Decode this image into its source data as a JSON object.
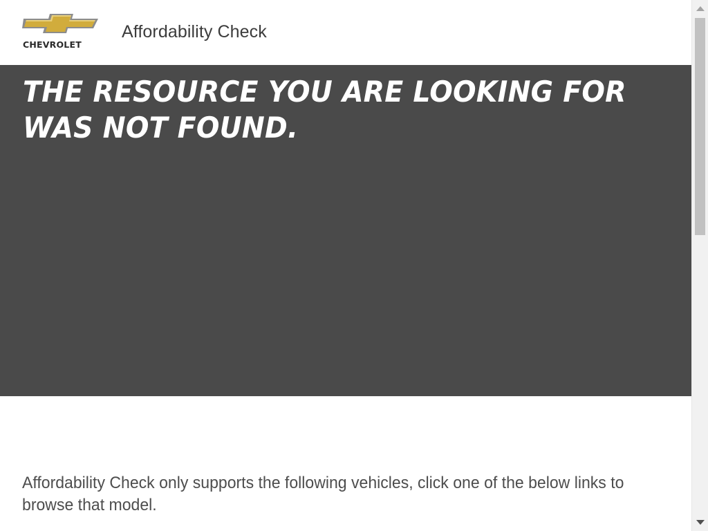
{
  "header": {
    "logo": {
      "icon": "chevrolet-bowtie-icon",
      "wordmark": "CHEVROLET",
      "colors": {
        "bowtie_gold": "#d1ac3c",
        "bowtie_outline": "#9a9a9a",
        "wordmark": "#2a2a2a"
      }
    },
    "app_title": "Affordability Check"
  },
  "hero": {
    "heading": "THE RESOURCE YOU ARE LOOKING FOR WAS NOT FOUND.",
    "background": "#4a4a4a"
  },
  "main": {
    "info_text": "Affordability Check only supports the following vehicles, click one of the below links to browse that model."
  },
  "scrollbar": {
    "up_icon": "scroll-up-arrow-icon",
    "down_icon": "scroll-down-arrow-icon"
  }
}
